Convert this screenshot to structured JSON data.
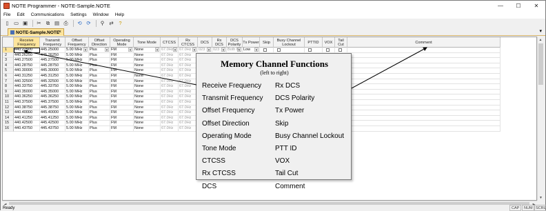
{
  "window": {
    "title": "NOTE Programmer - NOTE-Sample.NOTE",
    "min": "—",
    "max": "☐",
    "close": "✕"
  },
  "menu": [
    "File",
    "Edit",
    "Communications",
    "Settings",
    "Window",
    "Help"
  ],
  "toolbar_icons": [
    "new-icon",
    "open-icon",
    "save-icon",
    "cut-icon",
    "copy-icon",
    "paste-icon",
    "print-icon",
    "read-radio-icon",
    "write-radio-icon",
    "find-icon",
    "replace-icon",
    "help-icon"
  ],
  "tab": {
    "label": "NOTE-Sample.NOTE",
    "close": "×",
    "dropdown": "▾"
  },
  "columns": [
    {
      "label": "",
      "w": 16
    },
    {
      "label": "Receive Frequency",
      "w": 38
    },
    {
      "label": "Transmit Frequency",
      "w": 37
    },
    {
      "label": "Offset Frequency",
      "w": 34
    },
    {
      "label": "Offset Direction",
      "w": 31
    },
    {
      "label": "Operating Mode",
      "w": 34
    },
    {
      "label": "Tone Mode",
      "w": 39
    },
    {
      "label": "CTCSS",
      "w": 26
    },
    {
      "label": "Rx CTCSS",
      "w": 28
    },
    {
      "label": "DCS",
      "w": 21
    },
    {
      "label": "Rx DCS",
      "w": 21
    },
    {
      "label": "DCS Polarity",
      "w": 23
    },
    {
      "label": "Tx Power",
      "w": 25
    },
    {
      "label": "Skip",
      "w": 20
    },
    {
      "label": "Busy Channel Lockout",
      "w": 45
    },
    {
      "label": "PTTID",
      "w": 26
    },
    {
      "label": "VOX",
      "w": 18
    },
    {
      "label": "Tail Cut",
      "w": 18
    },
    {
      "label": "Comment",
      "w": 222
    }
  ],
  "rows": [
    [
      "1",
      "440.22500",
      "445.25000",
      "5.00 MHz",
      "Plus",
      "FM",
      "None",
      "67.0Hz",
      "67.0Hz",
      "023",
      "023",
      "Both N",
      "Low"
    ],
    [
      "2",
      "440.26250",
      "445.26250",
      "5.00 MHz",
      "Plus",
      "FM",
      "None",
      "67.0Hz",
      "67.0Hz",
      "",
      "",
      "",
      ""
    ],
    [
      "3",
      "440.27500",
      "445.27500",
      "5.00 MHz",
      "Plus",
      "FM",
      "None",
      "67.0Hz",
      "67.0Hz",
      "",
      "",
      "",
      ""
    ],
    [
      "4",
      "440.28750",
      "445.28750",
      "5.00 MHz",
      "Plus",
      "FM",
      "None",
      "67.0Hz",
      "67.0Hz",
      "",
      "",
      "",
      ""
    ],
    [
      "5",
      "440.30000",
      "445.30000",
      "5.00 MHz",
      "Plus",
      "FM",
      "None",
      "67.0Hz",
      "67.0Hz",
      "",
      "",
      "",
      ""
    ],
    [
      "6",
      "440.31250",
      "445.31250",
      "5.00 MHz",
      "Plus",
      "FM",
      "None",
      "67.0Hz",
      "67.0Hz",
      "",
      "",
      "",
      ""
    ],
    [
      "7",
      "440.32500",
      "445.32500",
      "5.00 MHz",
      "Plus",
      "FM",
      "None",
      "67.0Hz",
      "67.0Hz",
      "",
      "",
      "",
      ""
    ],
    [
      "8",
      "440.33750",
      "445.33750",
      "5.00 MHz",
      "Plus",
      "FM",
      "None",
      "67.0Hz",
      "67.0Hz",
      "",
      "",
      "",
      ""
    ],
    [
      "9",
      "440.35000",
      "445.35000",
      "5.00 MHz",
      "Plus",
      "FM",
      "None",
      "67.0Hz",
      "67.0Hz",
      "",
      "",
      "",
      ""
    ],
    [
      "10",
      "440.36250",
      "445.36250",
      "5.00 MHz",
      "Plus",
      "FM",
      "None",
      "67.0Hz",
      "67.0Hz",
      "",
      "",
      "",
      ""
    ],
    [
      "11",
      "440.37500",
      "445.37500",
      "5.00 MHz",
      "Plus",
      "FM",
      "None",
      "67.0Hz",
      "67.0Hz",
      "",
      "",
      "",
      ""
    ],
    [
      "12",
      "440.38750",
      "445.38750",
      "5.00 MHz",
      "Plus",
      "FM",
      "None",
      "67.0Hz",
      "67.0Hz",
      "",
      "",
      "",
      ""
    ],
    [
      "13",
      "440.40000",
      "445.40000",
      "5.00 MHz",
      "Plus",
      "FM",
      "None",
      "67.0Hz",
      "67.0Hz",
      "",
      "",
      "",
      ""
    ],
    [
      "14",
      "440.41250",
      "445.41250",
      "5.00 MHz",
      "Plus",
      "FM",
      "None",
      "67.0Hz",
      "67.0Hz",
      "",
      "",
      "",
      ""
    ],
    [
      "15",
      "440.42500",
      "445.42500",
      "5.00 MHz",
      "Plus",
      "FM",
      "None",
      "67.0Hz",
      "67.0Hz",
      "",
      "",
      "",
      ""
    ],
    [
      "16",
      "440.43750",
      "445.43750",
      "5.00 MHz",
      "Plus",
      "FM",
      "None",
      "67.0Hz",
      "67.0Hz",
      "",
      "",
      "",
      ""
    ]
  ],
  "popup": {
    "title": "Memory Channel Functions",
    "subtitle": "(left to right)",
    "left": [
      "Receive Frequency",
      "Transmit Frequency",
      "Offset Frequency",
      "Offset Direction",
      "Operating Mode",
      "Tone Mode",
      "CTCSS",
      "Rx CTCSS",
      "DCS"
    ],
    "right": [
      "Rx DCS",
      "DCS Polarity",
      "Tx Power",
      "Skip",
      "Busy Channel Lockout",
      "PTT ID",
      "VOX",
      "Tail Cut",
      "Comment"
    ]
  },
  "status": {
    "text": "Ready",
    "indicators": [
      "CAP",
      "NUM",
      "SCRL"
    ]
  },
  "colors": {
    "selected_header": "#fde49c",
    "tab_border": "#c9a14a"
  }
}
